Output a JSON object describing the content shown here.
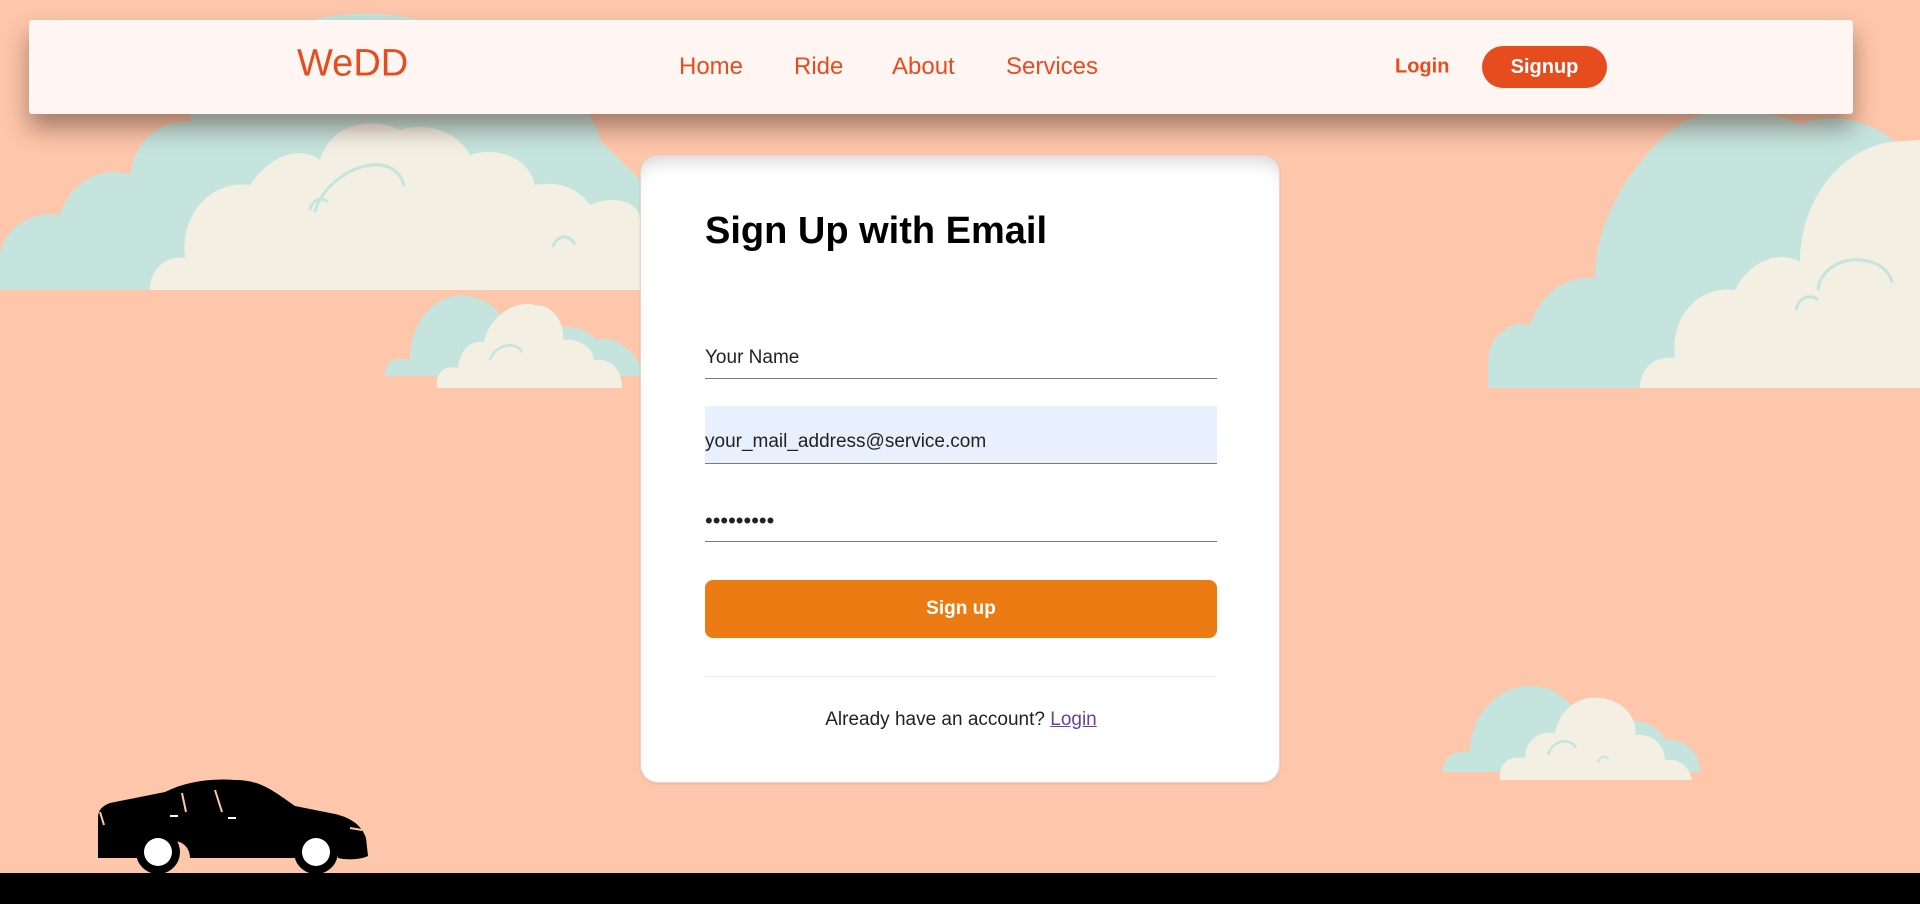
{
  "navbar": {
    "brand": "WeDD",
    "links": [
      "Home",
      "Ride",
      "About",
      "Services"
    ],
    "login_label": "Login",
    "signup_label": "Signup"
  },
  "signup_form": {
    "title": "Sign Up with Email",
    "name_placeholder": "Your Name",
    "email_value": "your_mail_address@service.com",
    "password_value": "•••••••••",
    "submit_label": "Sign up",
    "footer_prompt": "Already have an account?",
    "footer_link": "Login"
  },
  "colors": {
    "background": "#fec6aa",
    "brand": "#e64c1e",
    "submit": "#eb7b12",
    "cloud_teal": "#c5e4dd",
    "cloud_cream": "#f3efe3"
  },
  "icons": [
    "car-icon",
    "cloud-icon"
  ]
}
